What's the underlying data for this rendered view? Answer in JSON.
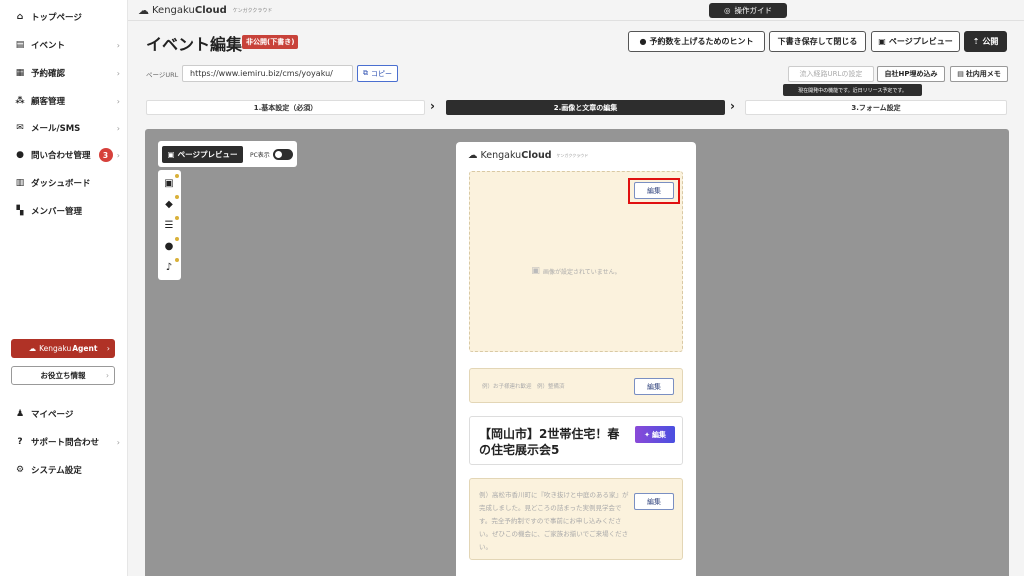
{
  "sidebar": {
    "items": [
      {
        "label": "トップページ",
        "icon": "home-icon"
      },
      {
        "label": "イベント",
        "icon": "document-icon"
      },
      {
        "label": "予約確認",
        "icon": "calendar-icon"
      },
      {
        "label": "顧客管理",
        "icon": "users-icon"
      },
      {
        "label": "メール/SMS",
        "icon": "mail-icon"
      },
      {
        "label": "問い合わせ管理",
        "icon": "chat-icon",
        "badge": "3"
      },
      {
        "label": "ダッシュボード",
        "icon": "chart-icon"
      },
      {
        "label": "メンバー管理",
        "icon": "grid-icon"
      }
    ],
    "agent": {
      "prefix": "Kengaku",
      "bold": "Agent"
    },
    "useful_info": "お役立ち情報",
    "bottom_items": [
      {
        "label": "マイページ",
        "icon": "person-icon"
      },
      {
        "label": "サポート問合わせ",
        "icon": "help-icon"
      },
      {
        "label": "システム設定",
        "icon": "gear-icon"
      }
    ]
  },
  "topbar": {
    "brand_prefix": "Kengaku",
    "brand_bold": "Cloud",
    "brand_kana": "ケンガククラウド",
    "guide": "操作ガイド"
  },
  "header": {
    "title": "イベント編集",
    "status": "非公開(下書き)",
    "hint_btn": "予約数を上げるためのヒント",
    "save_close_btn": "下書き保存して閉じる",
    "preview_btn": "ページプレビュー",
    "publish_btn": "公開"
  },
  "url_row": {
    "label": "ページURL",
    "url": "https://www.iemiru.biz/cms/yoyaku/",
    "copy": "コピー",
    "inflow_btn": "流入経路URLの設定",
    "embed_btn": "自社HP埋め込み",
    "memo_btn": "社内用メモ",
    "tooltip": "現在開発中の機能です。近日リリース予定です。"
  },
  "steps": [
    "1.基本設定（必須）",
    "2.画像と文章の編集",
    "3.フォーム設定"
  ],
  "editor": {
    "preview_btn": "ページプレビュー",
    "pc_label": "PC表示",
    "tools": [
      "image-tool-icon",
      "tag-tool-icon",
      "list-tool-icon",
      "chat-tool-icon",
      "bell-tool-icon"
    ]
  },
  "phone": {
    "brand_prefix": "Kengaku",
    "brand_bold": "Cloud",
    "brand_kana": "ケンガククラウド",
    "image_placeholder": "画像が設定されていません。",
    "edit": "編集",
    "tag_placeholder": "例）お子様連れ歓迎　例）整備済",
    "event_title": "【岡山市】2世帯住宅！春の住宅展示会5",
    "desc_placeholder": "例）高松市香川町に『吹き抜けと中庭のある家』が完成しました。見どころの詰まった実例見学会です。完全予約制ですので事前にお申し込みください。ぜひこの機会に、ご家族お揃いでご来場ください。"
  }
}
